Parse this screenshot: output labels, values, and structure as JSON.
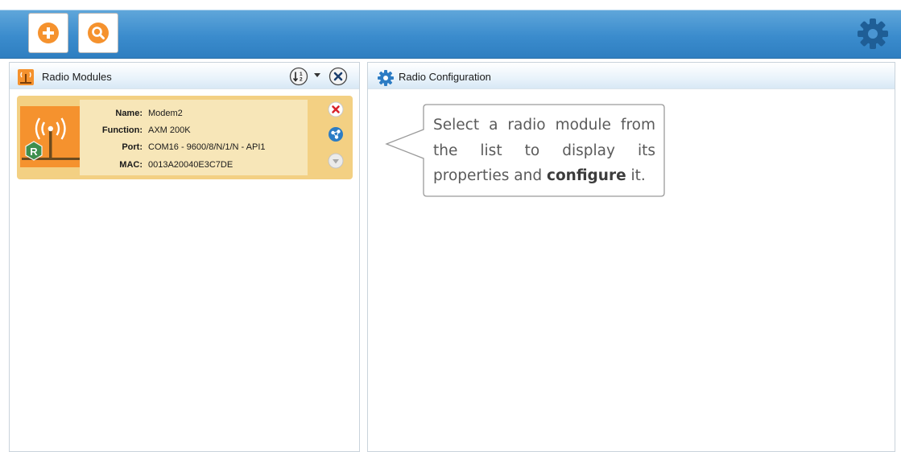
{
  "toolbar": {
    "buttons": [
      {
        "name": "add-radio-module",
        "icon": "plus-icon"
      },
      {
        "name": "discover-radio-modules",
        "icon": "search-icon"
      }
    ],
    "settings_icon": "gear-icon"
  },
  "left_panel": {
    "title": "Radio Modules",
    "header_icons": [
      "radio-modules-icon",
      "sort-icon",
      "close-icon"
    ]
  },
  "module": {
    "fields": [
      {
        "label": "Name:",
        "value": "Modem2"
      },
      {
        "label": "Function:",
        "value": "AXM 200K"
      },
      {
        "label": "Port:",
        "value": "COM16 - 9600/8/N/1/N - API1"
      },
      {
        "label": "MAC:",
        "value": "0013A20040E3C7DE"
      }
    ],
    "role_badge": "R",
    "actions": [
      "remove-icon",
      "network-icon",
      "expand-icon"
    ]
  },
  "right_panel": {
    "title": "Radio Configuration",
    "hint_plain": "Select a radio module from the list to display its properties and ",
    "hint_bold": "configure",
    "hint_end": " it."
  },
  "colors": {
    "toolbar_blue": "#3b8ccd",
    "accent_orange": "#f5922e",
    "card_bg": "#f3d083",
    "card_info_bg": "#f7e6b8",
    "remove_red": "#d8232a",
    "icon_blue": "#2c7cc4"
  }
}
